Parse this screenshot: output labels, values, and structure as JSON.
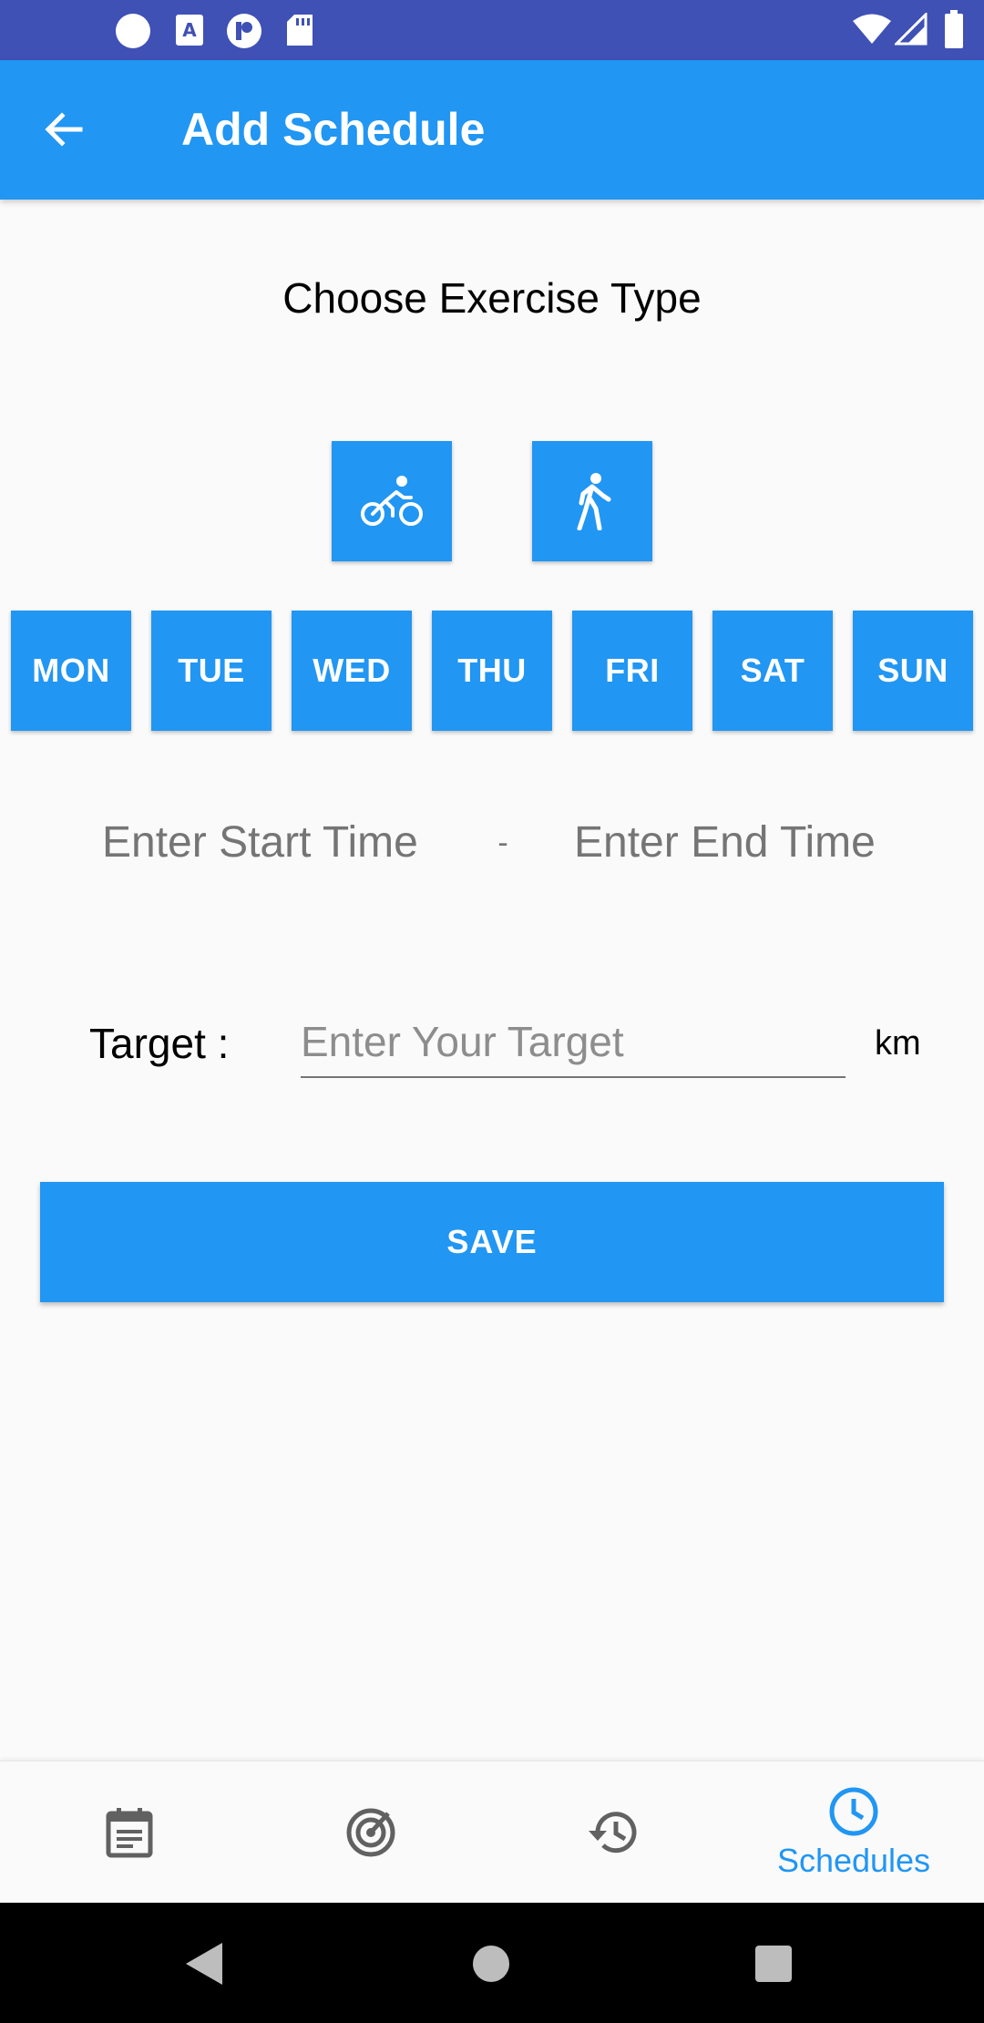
{
  "status_bar": {
    "left_icons": [
      "circle-icon",
      "a-letter-icon",
      "p-badge-icon",
      "sd-card-icon"
    ],
    "right_icons": [
      "wifi-icon",
      "signal-icon",
      "battery-icon"
    ]
  },
  "app_bar": {
    "title": "Add Schedule",
    "back_icon": "arrow-left-icon",
    "background": "#2196f3"
  },
  "exercise": {
    "heading": "Choose Exercise Type",
    "types": [
      {
        "icon": "bike-icon"
      },
      {
        "icon": "walk-icon"
      }
    ]
  },
  "days": [
    "MON",
    "TUE",
    "WED",
    "THU",
    "FRI",
    "SAT",
    "SUN"
  ],
  "time": {
    "start_placeholder": "Enter Start Time",
    "separator": "-",
    "end_placeholder": "Enter End Time"
  },
  "target": {
    "label": "Target :",
    "placeholder": "Enter Your Target",
    "value": "",
    "unit": "km"
  },
  "save_label": "SAVE",
  "bottom_nav": {
    "items": [
      {
        "icon": "calendar-note-icon",
        "label": ""
      },
      {
        "icon": "target-icon",
        "label": ""
      },
      {
        "icon": "history-icon",
        "label": ""
      },
      {
        "icon": "clock-icon",
        "label": "Schedules"
      }
    ],
    "active_color": "#2196f3",
    "inactive_color": "#616161"
  },
  "system_nav": [
    "back-triangle-icon",
    "home-circle-icon",
    "recents-square-icon"
  ]
}
